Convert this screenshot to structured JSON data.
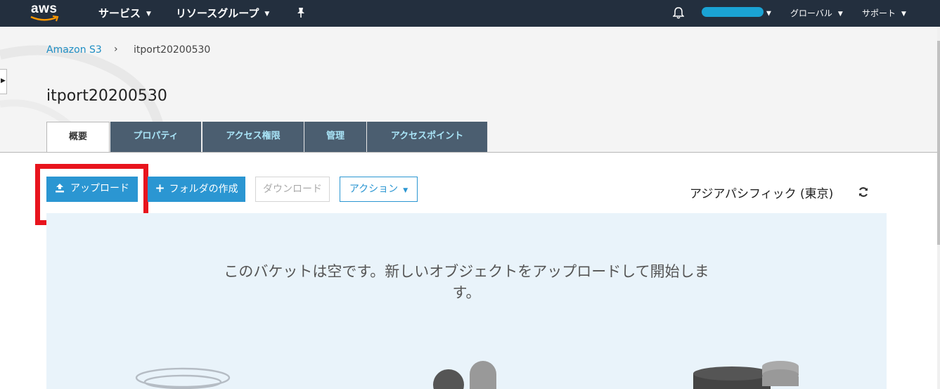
{
  "nav": {
    "logo": "aws",
    "services": "サービス",
    "resource_groups": "リソースグループ",
    "region_menu": "グローバル",
    "support_menu": "サポート",
    "caret": "⌄"
  },
  "breadcrumb": {
    "root": "Amazon S3",
    "separator": "›",
    "current": "itport20200530"
  },
  "page": {
    "title": "itport20200530"
  },
  "tabs": [
    {
      "label": "概要",
      "active": true
    },
    {
      "label": "プロパティ"
    },
    {
      "label": "アクセス権限"
    },
    {
      "label": "管理"
    },
    {
      "label": "アクセスポイント"
    }
  ],
  "toolbar": {
    "upload": "アップロード",
    "create_folder": "フォルダの作成",
    "download": "ダウンロード",
    "actions": "アクション"
  },
  "region": "アジアパシフィック (東京)",
  "empty_state": {
    "message": "このバケットは空です。新しいオブジェクトをアップロードして開始します。"
  },
  "colors": {
    "nav_bg": "#232f3e",
    "accent": "#2b96d2",
    "highlight": "#e8141d",
    "panel_bg": "#e9f3fa"
  }
}
